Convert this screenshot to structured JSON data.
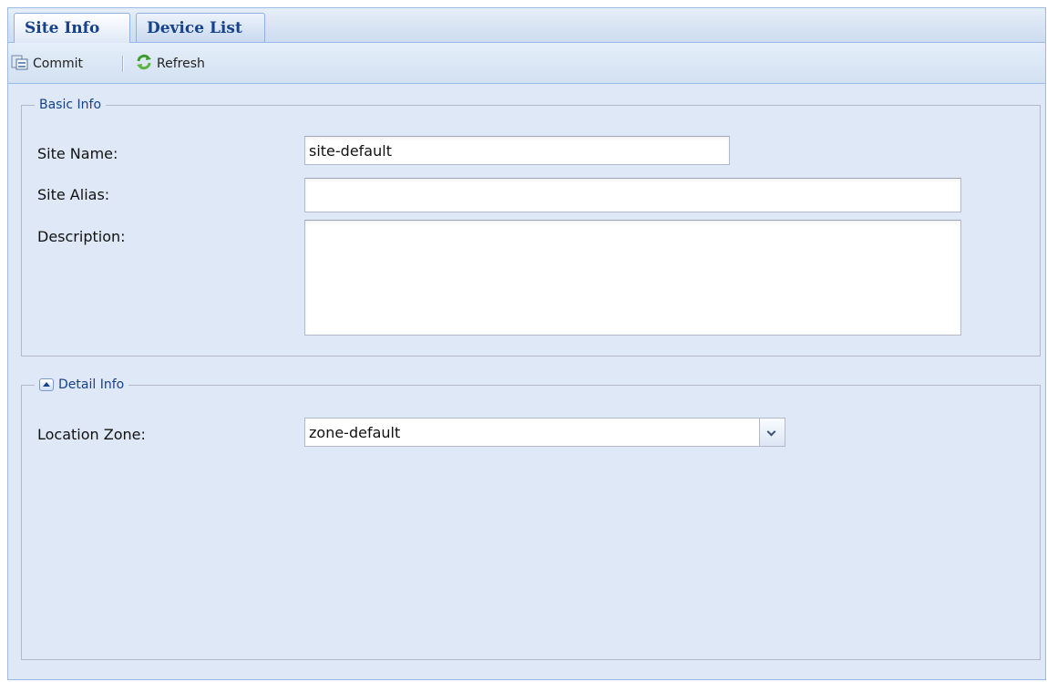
{
  "tabs": [
    {
      "label": "Site Info",
      "active": true
    },
    {
      "label": "Device List",
      "active": false
    }
  ],
  "toolbar": {
    "commit_label": "Commit",
    "refresh_label": "Refresh",
    "commit_icon": "commit-icon",
    "refresh_icon": "refresh-icon"
  },
  "basic_info": {
    "legend": "Basic Info",
    "site_name_label": "Site Name:",
    "site_name_value": "site-default",
    "site_alias_label": "Site Alias:",
    "site_alias_value": "",
    "description_label": "Description:",
    "description_value": ""
  },
  "detail_info": {
    "legend": "Detail Info",
    "collapse_icon": "collapse-icon",
    "location_zone_label": "Location Zone:",
    "location_zone_value": "zone-default"
  },
  "colors": {
    "panel_bg": "#dfe8f6",
    "border": "#99bbe8",
    "tab_text": "#15428b",
    "field_border": "#b5b8c8"
  }
}
